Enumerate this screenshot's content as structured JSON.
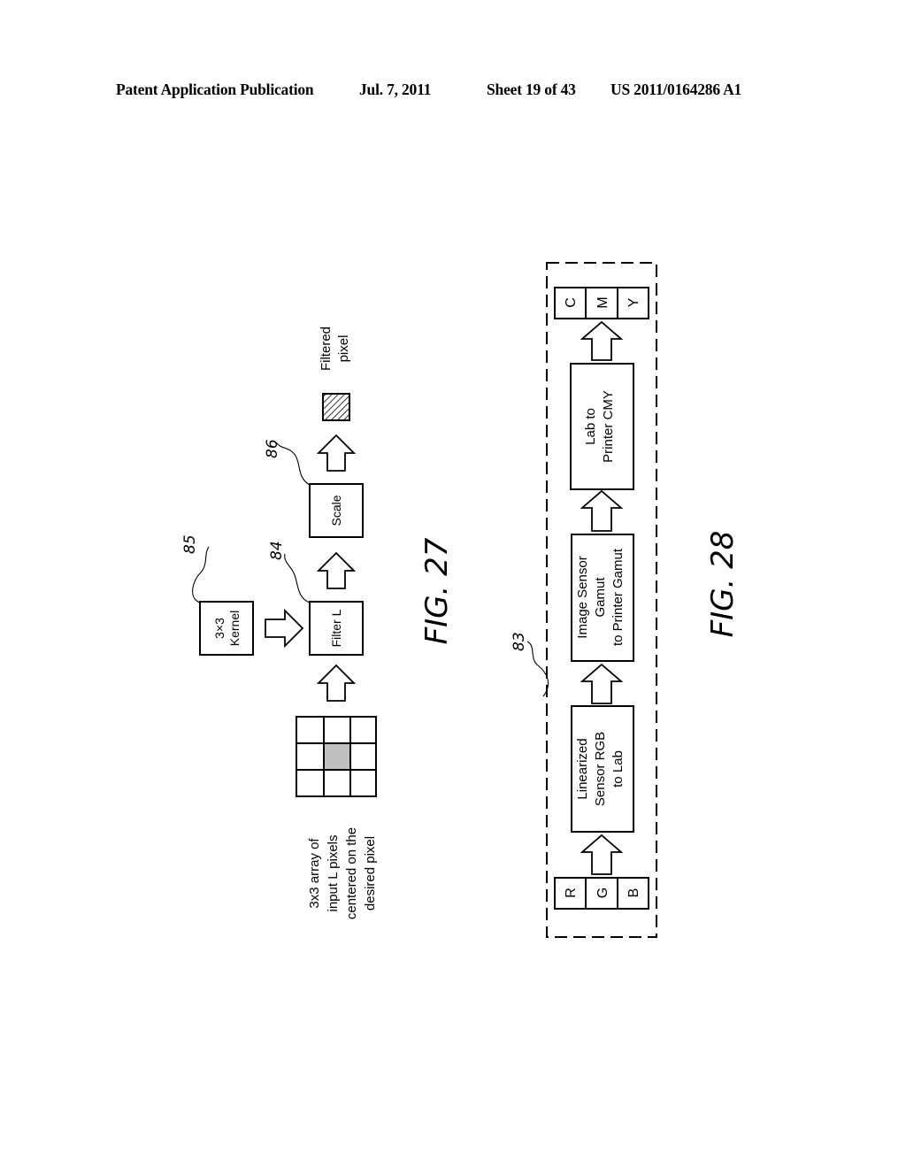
{
  "header": {
    "publication": "Patent Application Publication",
    "date": "Jul. 7, 2011",
    "sheet": "Sheet 19 of 43",
    "number": "US 2011/0164286 A1"
  },
  "fig27": {
    "caption": "FIG. 27",
    "input_label": [
      "3x3 array of",
      "input L pixels",
      "centered on the",
      "desired pixel"
    ],
    "kernel_label": [
      "3×3",
      "Kernel"
    ],
    "kernel_ref": "85",
    "filter_label": "Filter L",
    "filter_ref": "84",
    "scale_label": "Scale",
    "scale_ref": "86",
    "output_label": [
      "Filtered",
      "pixel"
    ]
  },
  "fig28": {
    "caption": "FIG. 28",
    "group_ref": "83",
    "input_channels": [
      "R",
      "G",
      "B"
    ],
    "blocks": [
      [
        "Linearized",
        "Sensor RGB",
        "to Lab"
      ],
      [
        "Image Sensor",
        "Gamut",
        "to Printer Gamut"
      ],
      [
        "Lab to",
        "Printer CMY"
      ]
    ],
    "output_channels": [
      "C",
      "M",
      "Y"
    ]
  },
  "colors": {
    "ink": "#000000",
    "center_pixel": "#c0c0c0",
    "paper": "#ffffff"
  }
}
